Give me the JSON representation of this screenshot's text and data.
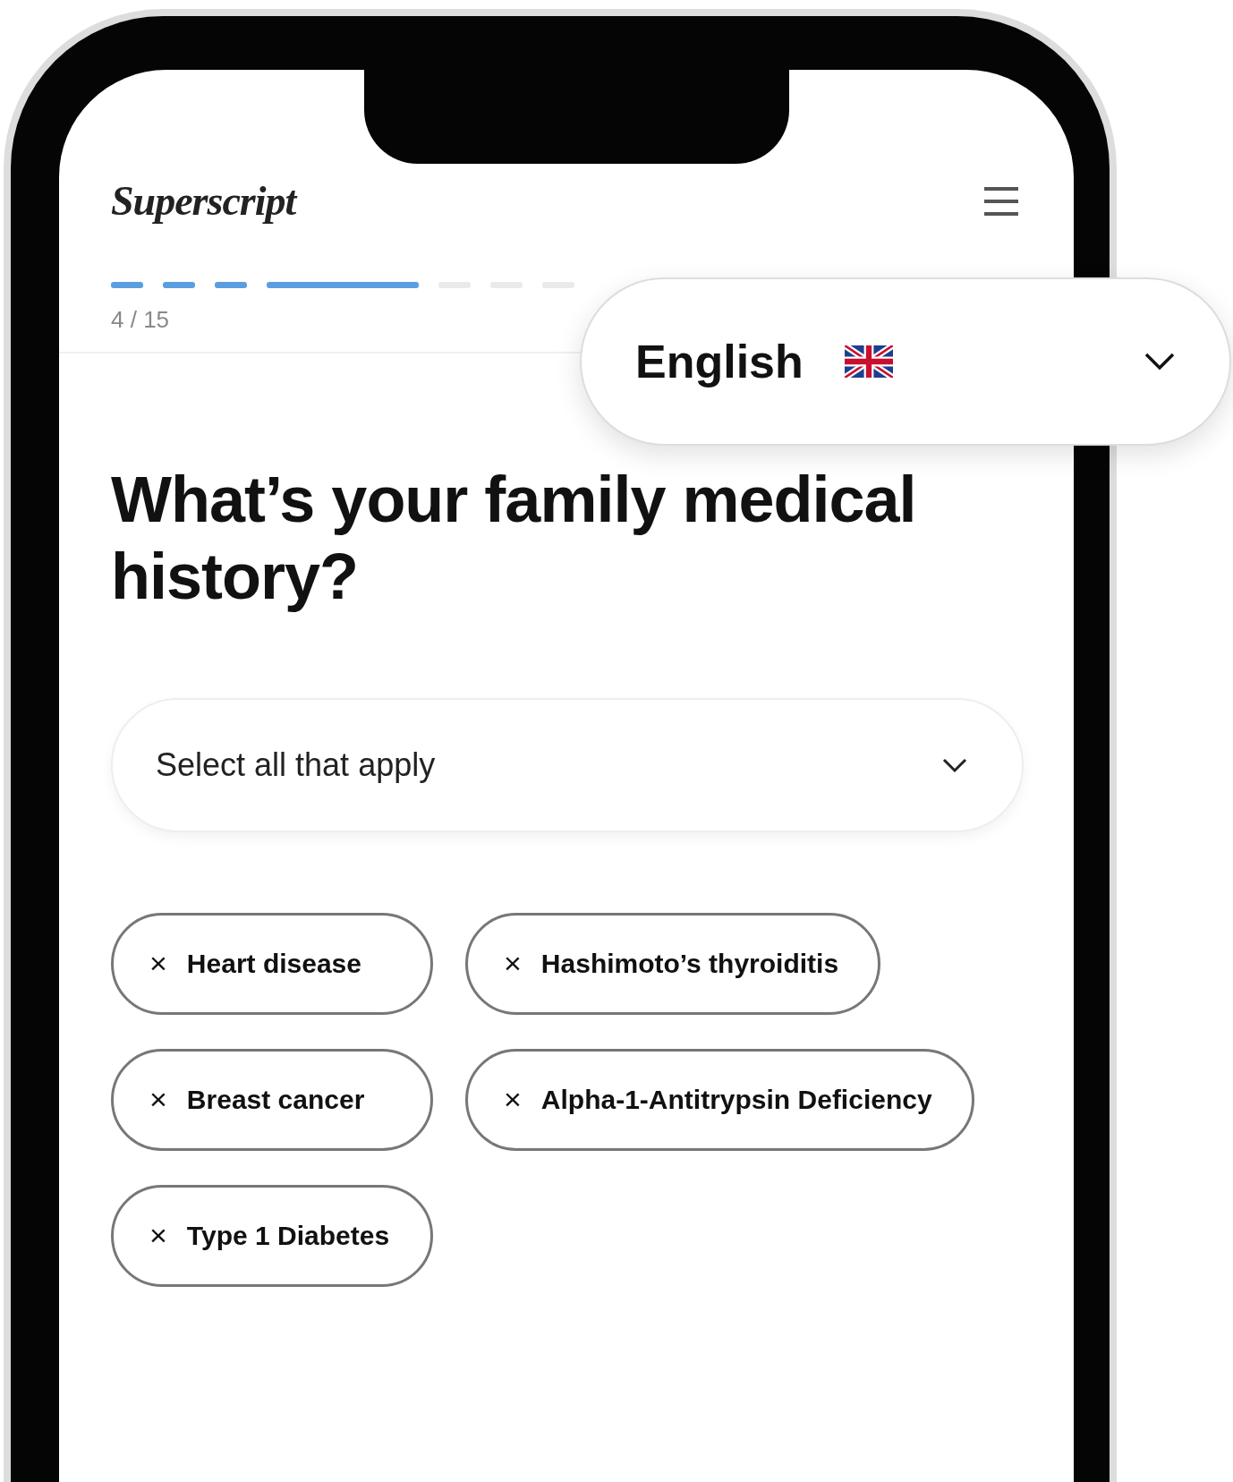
{
  "header": {
    "logo": "Superscript"
  },
  "progress": {
    "label": "4 / 15",
    "steps": [
      {
        "filled": true
      },
      {
        "filled": true
      },
      {
        "filled": true
      },
      {
        "filled": true
      },
      {
        "filled": false
      },
      {
        "filled": false
      },
      {
        "filled": false
      }
    ]
  },
  "language": {
    "label": "English"
  },
  "question": "What’s your family medical history?",
  "select": {
    "placeholder": "Select all that apply"
  },
  "chips": [
    {
      "remove": "×",
      "label": "Heart disease"
    },
    {
      "remove": "×",
      "label": "Hashimoto’s thyroiditis"
    },
    {
      "remove": "×",
      "label": "Breast cancer"
    },
    {
      "remove": "×",
      "label": "Alpha-1-Antitrypsin Deficiency"
    },
    {
      "remove": "×",
      "label": "Type 1 Diabetes"
    }
  ]
}
